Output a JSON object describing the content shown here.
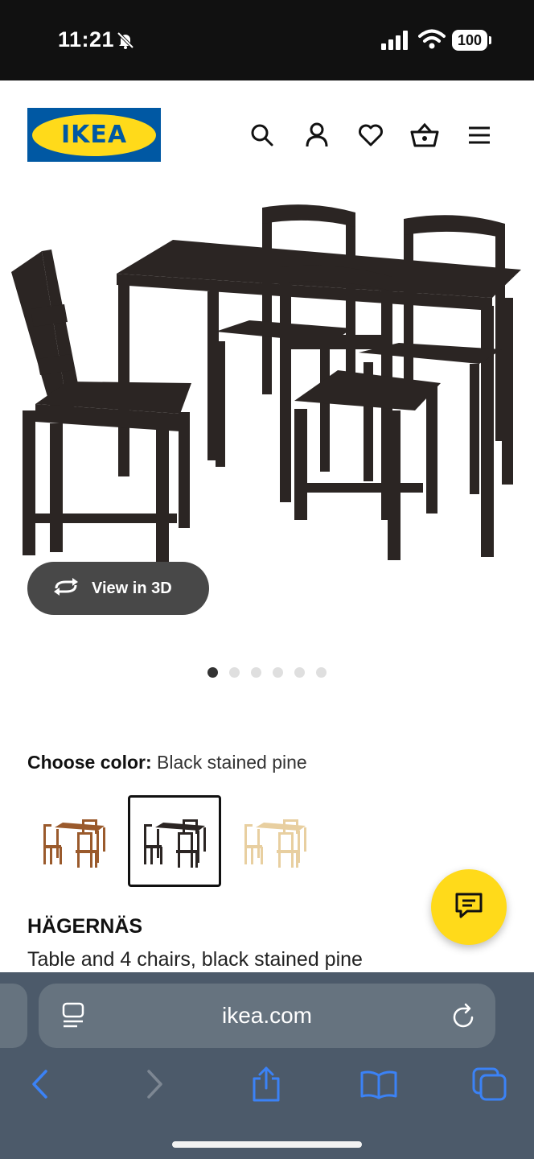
{
  "status_bar": {
    "time": "11:21",
    "battery": "100"
  },
  "header": {
    "logo_text": "IKEA",
    "icons": [
      "search-icon",
      "account-icon",
      "heart-icon",
      "basket-icon",
      "menu-icon"
    ]
  },
  "product_image": {
    "view_3d_label": "View in 3D",
    "carousel": {
      "total": 6,
      "active": 1
    }
  },
  "color_picker": {
    "label": "Choose color:",
    "selected_value": "Black stained pine",
    "options": [
      "brown-stained-pine",
      "black-stained-pine",
      "pine"
    ]
  },
  "product": {
    "name": "HÄGERNÄS",
    "description": "Table and 4 chairs, black stained pine"
  },
  "browser": {
    "url": "ikea.com"
  },
  "colors": {
    "ikea_blue": "#0058a3",
    "ikea_yellow": "#ffda1a",
    "browser_chrome": "#4c5a6a",
    "browser_accent": "#3b82f6"
  }
}
